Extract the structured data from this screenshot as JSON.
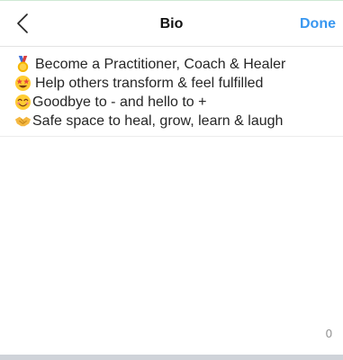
{
  "nav": {
    "back_icon": "chevron-left-icon",
    "title": "Bio",
    "done_label": "Done"
  },
  "bio": {
    "lines": [
      {
        "icon": "medal-icon",
        "text": "Become a Practitioner, Coach & Healer"
      },
      {
        "icon": "star-struck-face-icon",
        "text": "Help others transform & feel fulfilled"
      },
      {
        "icon": "smiling-face-icon",
        "text": "Goodbye to - and hello to +"
      },
      {
        "icon": "handshake-icon",
        "text": "Safe space to heal, grow, learn & laugh"
      }
    ]
  },
  "counter": {
    "value": "0"
  },
  "colors": {
    "accent": "#3897f0",
    "text": "#262626",
    "muted": "#8e8e8e"
  }
}
